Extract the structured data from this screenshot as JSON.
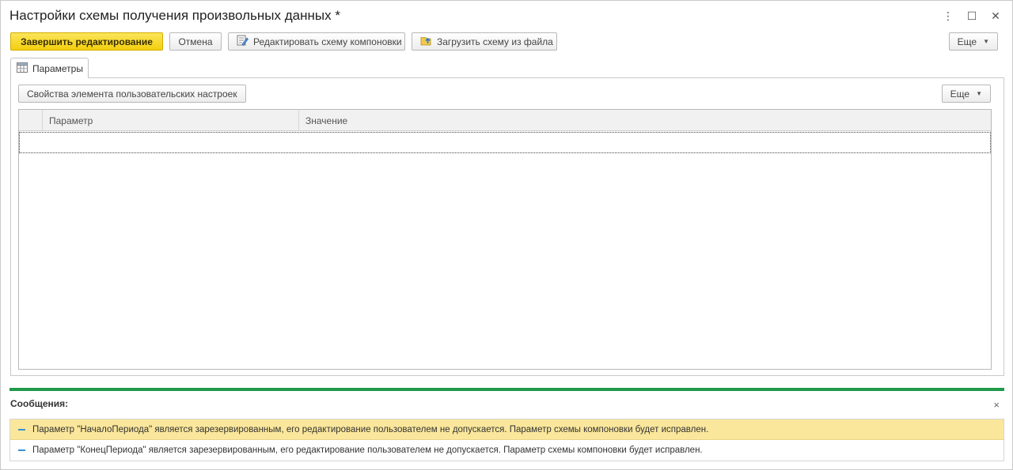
{
  "window": {
    "title": "Настройки схемы получения произвольных данных *",
    "controls": {
      "more": "⋮",
      "maximize": "☐",
      "close": "✕"
    }
  },
  "toolbar": {
    "finish_label": "Завершить редактирование",
    "cancel_label": "Отмена",
    "edit_schema_label": "Редактировать схему компоновки",
    "load_schema_label": "Загрузить схему из файла",
    "more_label": "Еще"
  },
  "tab": {
    "label": "Параметры"
  },
  "panel": {
    "properties_label": "Свойства элемента пользовательских настроек",
    "more_label": "Еще"
  },
  "table": {
    "columns": [
      "Параметр",
      "Значение"
    ],
    "rows": []
  },
  "messages": {
    "title": "Сообщения:",
    "close": "×",
    "items": [
      "Параметр \"НачалоПериода\" является зарезервированным, его редактирование пользователем не допускается. Параметр схемы компоновки будет исправлен.",
      "Параметр \"КонецПериода\" является зарезервированным, его редактирование пользователем не допускается. Параметр схемы компоновки будет исправлен."
    ]
  },
  "colors": {
    "primary_button": "#f3cf0f",
    "messages_divider": "#1f9a4a",
    "highlighted_message": "#fbe79b"
  },
  "icons": {
    "edit_schema": "edit-schema-icon",
    "load_schema": "upload-file-icon",
    "tab": "parameters-table-icon"
  }
}
